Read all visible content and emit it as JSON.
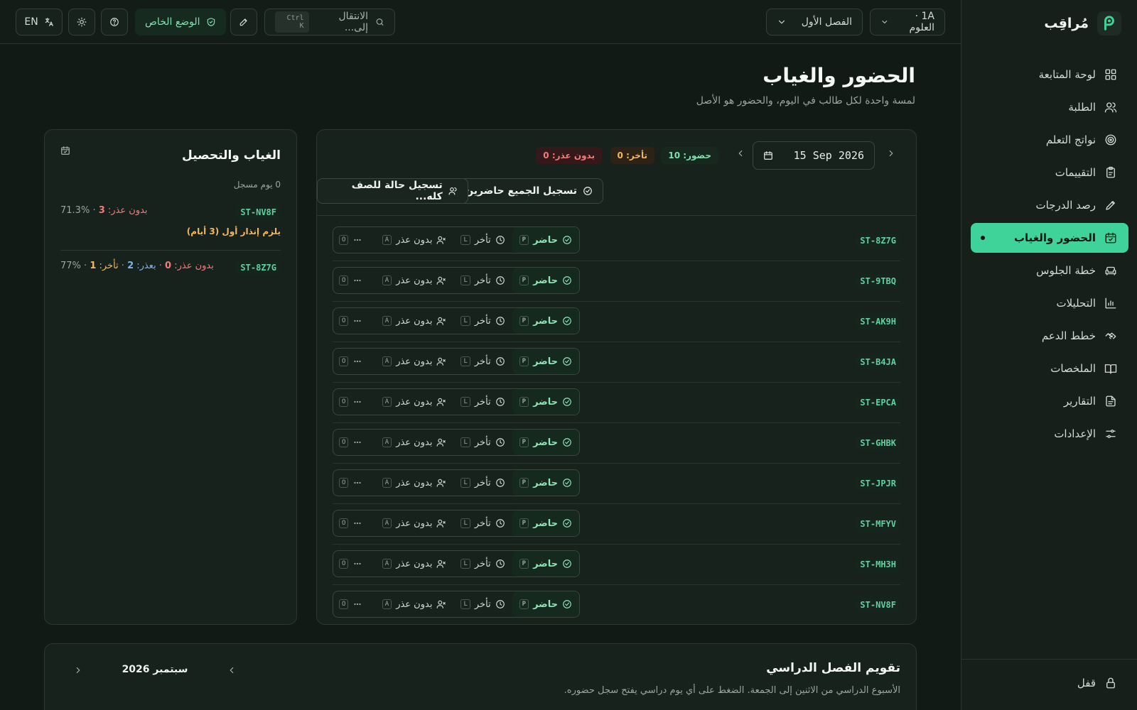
{
  "brand": {
    "name": "مُراقِب"
  },
  "sidebar": {
    "items": [
      {
        "label": "لوحة المتابعة"
      },
      {
        "label": "الطلبة"
      },
      {
        "label": "نواتج التعلم"
      },
      {
        "label": "التقييمات"
      },
      {
        "label": "رصد الدرجات"
      },
      {
        "label": "الحضور والغياب"
      },
      {
        "label": "خطة الجلوس"
      },
      {
        "label": "التحليلات"
      },
      {
        "label": "خطط الدعم"
      },
      {
        "label": "الملخصات"
      },
      {
        "label": "التقارير"
      },
      {
        "label": "الإعدادات"
      }
    ],
    "lock": "قفل"
  },
  "header": {
    "class_select": "1A · العلوم",
    "term_select": "الفصل الأول",
    "search_placeholder": "الانتقال إلى...",
    "search_kbd": "Ctrl K",
    "private_mode": "الوضع الخاص",
    "lang": "EN"
  },
  "page": {
    "title": "الحضور والغياب",
    "subtitle": "لمسة واحدة لكل طالب في اليوم، والحضور هو الأصل"
  },
  "attendance": {
    "date": "15 Sep 2026",
    "present_chip": "حضور: 10",
    "late_chip": "تأخر: 0",
    "unexcused_chip": "بدون عذر: 0",
    "mark_all_present": "تسجيل الجميع حاضرين",
    "mark_class_status": "تسجيل حالة للصف كله...",
    "status_labels": {
      "present": "حاضر",
      "present_key": "P",
      "late": "تأخر",
      "late_key": "L",
      "unexcused": "بدون عذر",
      "unexcused_key": "A",
      "other_key": "O"
    },
    "students": [
      {
        "id": "ST-8Z7G"
      },
      {
        "id": "ST-9TBQ"
      },
      {
        "id": "ST-AK9H"
      },
      {
        "id": "ST-B4JA"
      },
      {
        "id": "ST-EPCA"
      },
      {
        "id": "ST-GHBK"
      },
      {
        "id": "ST-JPJR"
      },
      {
        "id": "ST-MFYV"
      },
      {
        "id": "ST-MH3H"
      },
      {
        "id": "ST-NV8F"
      }
    ]
  },
  "absence": {
    "title": "الغياب والتحصيل",
    "days_recorded": "0 يوم مسجل",
    "entries": [
      {
        "id": "ST-NV8F",
        "unexcused_label": "بدون عذر:",
        "unexcused": "3",
        "sep": " · ",
        "pct": "%71.3",
        "warning": "يلزم إنذار أول (3 أيام)"
      },
      {
        "id": "ST-8Z7G",
        "unexcused_label": "بدون عذر:",
        "unexcused": "0",
        "excused_label": "بعذر:",
        "excused": "2",
        "late_label": "تأخر:",
        "late": "1",
        "pct": "%77"
      }
    ]
  },
  "calendar": {
    "title": "تقويم الفصل الدراسي",
    "subtitle": "الأسبوع الدراسي من الاثنين إلى الجمعة. الضغط على أي يوم دراسي يفتح سجل حضوره.",
    "month": "سبتمبر 2026"
  },
  "colors": {
    "accent": "#3fd39a",
    "bg": "#111a15",
    "warn": "#f5b661",
    "danger": "#f07c7c"
  }
}
